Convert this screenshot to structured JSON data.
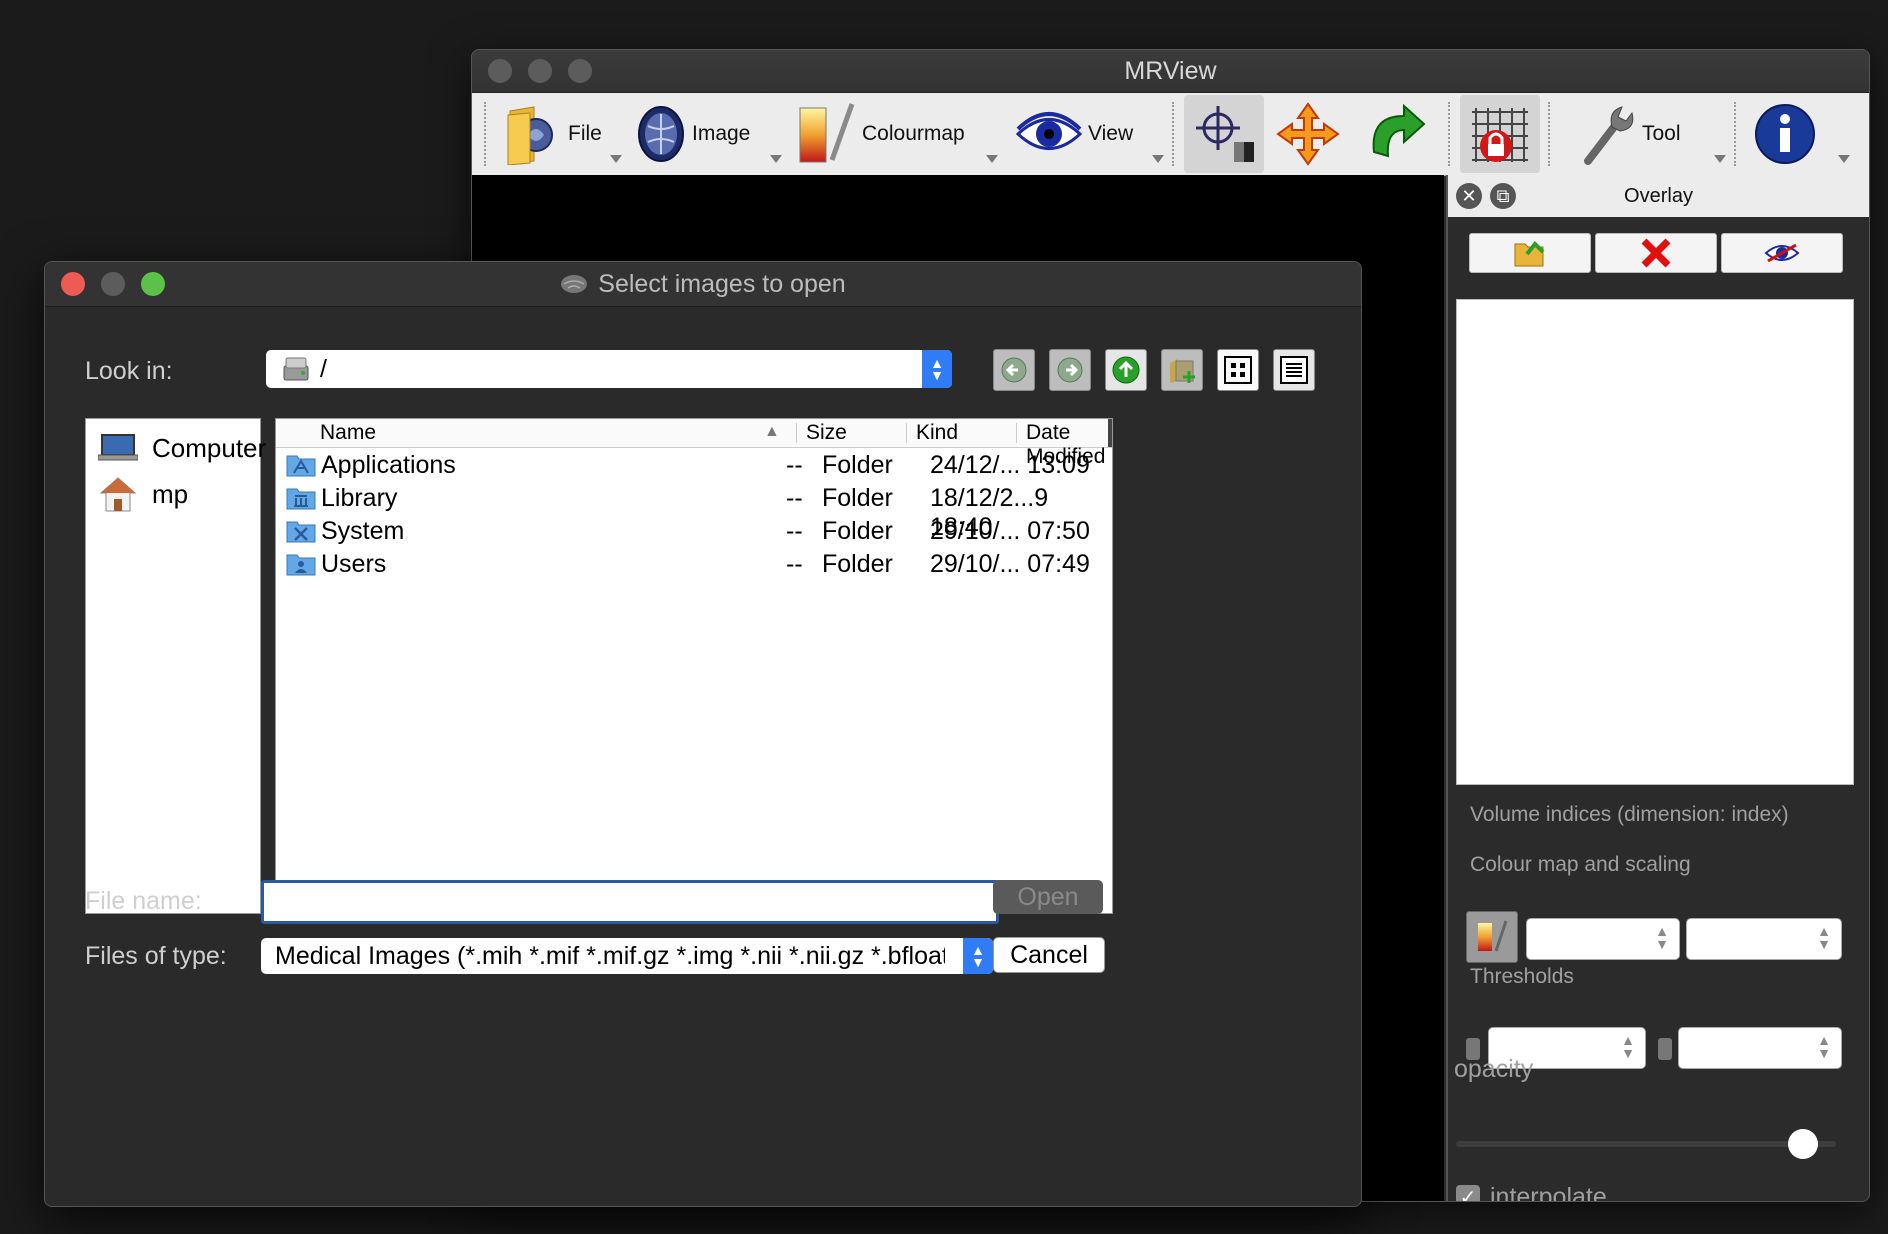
{
  "mrview": {
    "title": "MRView",
    "toolbar": {
      "file": "File",
      "image": "Image",
      "colourmap": "Colourmap",
      "view": "View",
      "tool": "Tool"
    },
    "overlay": {
      "title": "Overlay",
      "volume_indices": "Volume indices (dimension: index)",
      "colour_map_scaling": "Colour map and scaling",
      "thresholds": "Thresholds",
      "opacity": "opacity",
      "interpolate": "interpolate",
      "interpolate_checked": true,
      "opacity_level": 0.95
    }
  },
  "dialog": {
    "title": "Select images to open",
    "look_in_label": "Look in:",
    "look_in_value": "/",
    "sidebar": [
      {
        "label": "Computer",
        "icon": "computer-icon"
      },
      {
        "label": "mp",
        "icon": "home-icon"
      }
    ],
    "columns": {
      "name": "Name",
      "size": "Size",
      "kind": "Kind",
      "date": "Date Modified"
    },
    "files": [
      {
        "name": "Applications",
        "size": "--",
        "kind": "Folder",
        "date": "24/12/... 13:09"
      },
      {
        "name": "Library",
        "size": "--",
        "kind": "Folder",
        "date": "18/12/2...9 18:40"
      },
      {
        "name": "System",
        "size": "--",
        "kind": "Folder",
        "date": "29/10/... 07:50"
      },
      {
        "name": "Users",
        "size": "--",
        "kind": "Folder",
        "date": "29/10/... 07:49"
      }
    ],
    "file_name_label": "File name:",
    "file_name_value": "",
    "files_of_type_label": "Files of type:",
    "files_of_type_value": "Medical Images (*.mih *.mif *.mif.gz *.img *.nii *.nii.gz *.bfloat *.bshc",
    "open_label": "Open",
    "cancel_label": "Cancel"
  },
  "colors": {
    "accent": "#2f7cf6",
    "close": "#ee5b54",
    "maximize": "#5cc148"
  }
}
